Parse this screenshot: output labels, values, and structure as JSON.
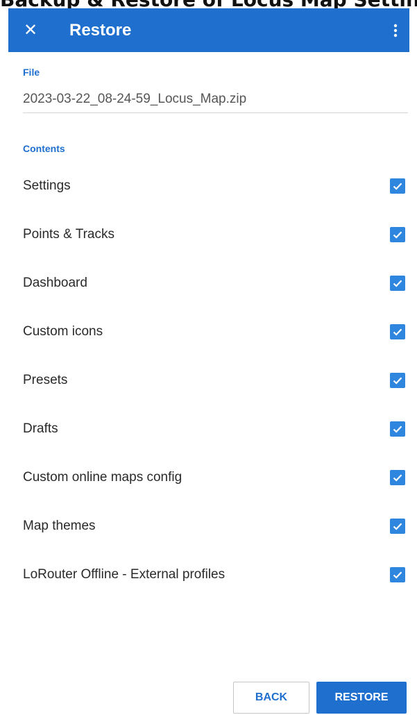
{
  "top_caption": "Backup & Restore of Locus Map Settings and User Data",
  "appbar": {
    "close_icon": "close-icon",
    "title": "Restore",
    "more_icon": "more-vert-icon",
    "color": "#1f6fcf"
  },
  "file": {
    "label": "File",
    "value": "2023-03-22_08-24-59_Locus_Map.zip"
  },
  "contents": {
    "label": "Contents",
    "items": [
      {
        "label": "Settings",
        "checked": true
      },
      {
        "label": "Points & Tracks",
        "checked": true
      },
      {
        "label": "Dashboard",
        "checked": true
      },
      {
        "label": "Custom icons",
        "checked": true
      },
      {
        "label": "Presets",
        "checked": true
      },
      {
        "label": "Drafts",
        "checked": true
      },
      {
        "label": "Custom online maps config",
        "checked": true
      },
      {
        "label": "Map themes",
        "checked": true
      },
      {
        "label": "LoRouter Offline - External profiles",
        "checked": true
      }
    ]
  },
  "buttons": {
    "back": "BACK",
    "restore": "RESTORE"
  }
}
